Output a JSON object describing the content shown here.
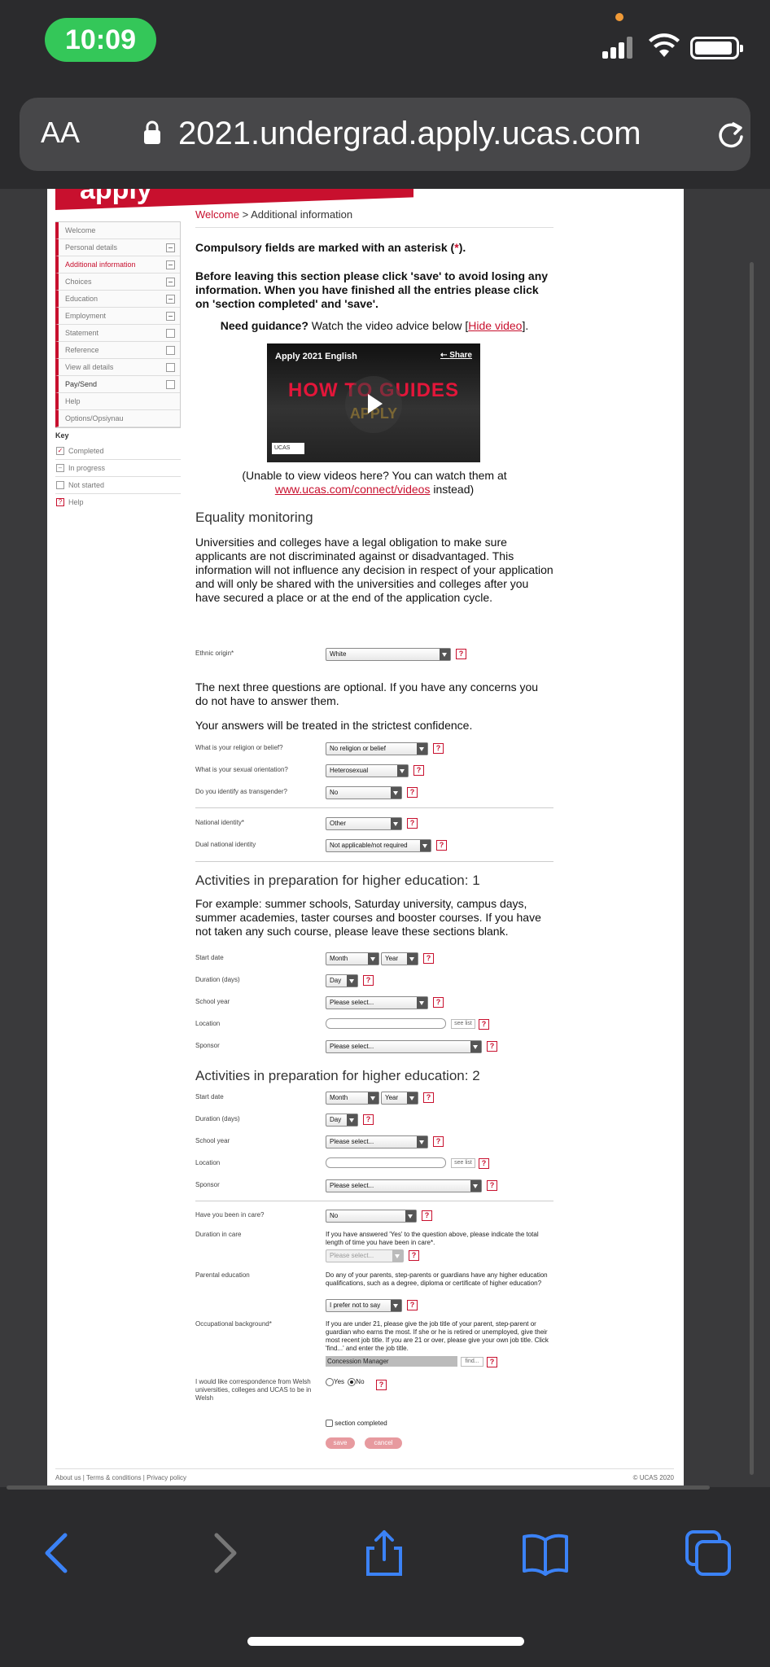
{
  "status": {
    "time": "10:09"
  },
  "browser": {
    "text_size": "AA",
    "url": "2021.undergrad.apply.ucas.com"
  },
  "banner": {
    "text": "apply"
  },
  "sidebar": {
    "items": [
      {
        "label": "Welcome",
        "status": "none"
      },
      {
        "label": "Personal details",
        "status": "in-progress"
      },
      {
        "label": "Additional information",
        "status": "in-progress"
      },
      {
        "label": "Choices",
        "status": "in-progress"
      },
      {
        "label": "Education",
        "status": "in-progress"
      },
      {
        "label": "Employment",
        "status": "in-progress"
      },
      {
        "label": "Statement",
        "status": "not-started"
      },
      {
        "label": "Reference",
        "status": "not-started"
      },
      {
        "label": "View all details",
        "status": "not-started"
      },
      {
        "label": "Pay/Send",
        "status": "not-started"
      },
      {
        "label": "Help",
        "status": "none"
      },
      {
        "label": "Options/Opsiynau",
        "status": "none"
      }
    ],
    "key_title": "Key",
    "key": [
      "Completed",
      "In progress",
      "Not started",
      "Help"
    ]
  },
  "breadcrumb": {
    "home": "Welcome",
    "sep": " > ",
    "current": "Additional information"
  },
  "intro": {
    "compulsory_a": "Compulsory fields are marked with an asterisk (",
    "asterisk": "*",
    "compulsory_b": ").",
    "save_note": "Before leaving this section please click 'save' to avoid losing any information. When you have finished all the entries please click on 'section completed' and 'save'.",
    "guidance_bold": "Need guidance?",
    "guidance_text": " Watch the video advice below [",
    "hide_video": "Hide video",
    "guidance_end": "]."
  },
  "video": {
    "title": "Apply 2021 English",
    "share": "Share",
    "headline": "HOW TO GUIDES",
    "subline": "APPLY",
    "logo": "UCAS",
    "note_a": "(Unable to view videos here? You can watch them at",
    "note_link": "www.ucas.com/connect/videos",
    "note_b": " instead)"
  },
  "equality": {
    "heading": "Equality monitoring",
    "para": "Universities and colleges have a legal obligation to make sure applicants are not discriminated against or disadvantaged. This information will not influence any decision in respect of your application and will only be shared with the universities and colleges after you have secured a place or at the end of the application cycle.",
    "ethnic_label": "Ethnic origin*",
    "ethnic_value": "White",
    "optional_note": "The next three questions are optional. If you have any concerns you do not have to answer them.",
    "confidence_note": "Your answers will be treated in the strictest confidence.",
    "religion_label": "What is your religion or belief?",
    "religion_value": "No religion or belief",
    "orientation_label": "What is your sexual orientation?",
    "orientation_value": "Heterosexual",
    "transgender_label": "Do you identify as transgender?",
    "transgender_value": "No",
    "national_label": "National identity*",
    "national_value": "Other",
    "dual_label": "Dual national identity",
    "dual_value": "Not applicable/not required"
  },
  "activities1": {
    "heading": "Activities in preparation for higher education: 1",
    "para": "For example: summer schools, Saturday university, campus days, summer academies, taster courses and booster courses. If you have not taken any such course, please leave these sections blank.",
    "start_label": "Start date",
    "month": "Month",
    "year": "Year",
    "duration_label": "Duration (days)",
    "day": "Day",
    "school_label": "School year",
    "school_value": "Please select...",
    "location_label": "Location",
    "see_list": "see list",
    "sponsor_label": "Sponsor",
    "sponsor_value": "Please select..."
  },
  "activities2": {
    "heading": "Activities in preparation for higher education: 2",
    "start_label": "Start date",
    "month": "Month",
    "year": "Year",
    "duration_label": "Duration (days)",
    "day": "Day",
    "school_label": "School year",
    "school_value": "Please select...",
    "location_label": "Location",
    "see_list": "see list",
    "sponsor_label": "Sponsor",
    "sponsor_value": "Please select..."
  },
  "care": {
    "care_label": "Have you been in care?",
    "care_value": "No",
    "duration_label": "Duration in care",
    "duration_note": "If you have answered 'Yes' to the question above, please indicate the total length of time you have been in care*.",
    "duration_value": "Please select...",
    "parental_label": "Parental education",
    "parental_note": "Do any of your parents, step-parents or guardians have any higher education qualifications, such as a degree, diploma or certificate of higher education?",
    "parental_value": "I prefer not to say",
    "occupation_label": "Occupational background*",
    "occupation_note": "If you are under 21, please give the job title of your parent, step-parent or guardian who earns the most. If she or he is retired or unemployed, give their most recent job title. If you are 21 or over, please give your own job title. Click 'find...' and enter the job title.",
    "occupation_value": "Concession Manager",
    "find": "find...",
    "welsh_label": "I would like correspondence from Welsh universities, colleges and UCAS to be in Welsh",
    "yes": "Yes",
    "no": "No"
  },
  "actions": {
    "section_completed": "section completed",
    "save": "save",
    "cancel": "cancel"
  },
  "footer": {
    "links": "About us | Terms & conditions | Privacy policy",
    "copyright": "© UCAS 2020"
  }
}
